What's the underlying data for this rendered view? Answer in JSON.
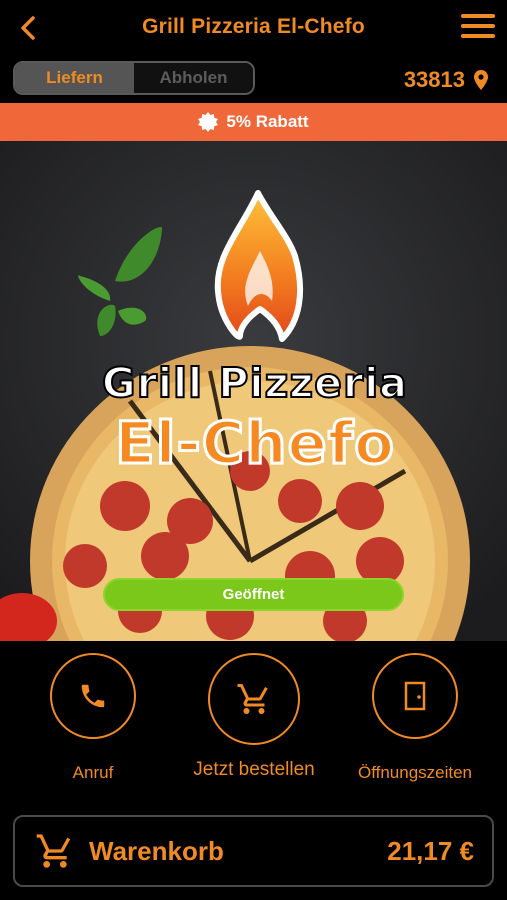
{
  "header": {
    "title": "Grill Pizzeria El-Chefo",
    "back_icon": "chevron-left-icon",
    "menu_icon": "hamburger-menu-icon"
  },
  "mode_toggle": {
    "deliver_label": "Liefern",
    "pickup_label": "Abholen",
    "selected": "Liefern"
  },
  "location": {
    "zip": "33813",
    "icon": "map-pin-icon"
  },
  "discount_banner": {
    "text": "5% Rabatt",
    "icon": "badge-icon"
  },
  "hero": {
    "logo_line1": "Grill Pizzeria",
    "logo_line2": "El-Chefo",
    "status_label": "Geöffnet"
  },
  "actions": {
    "call_label": "Anruf",
    "order_label": "Jetzt bestellen",
    "hours_label": "Öffnungszeiten"
  },
  "cart": {
    "label": "Warenkorb",
    "total": "21,17 €"
  },
  "colors": {
    "accent": "#f08a24",
    "banner": "#f0673a",
    "open_green": "#7bc81a",
    "background": "#000000"
  }
}
